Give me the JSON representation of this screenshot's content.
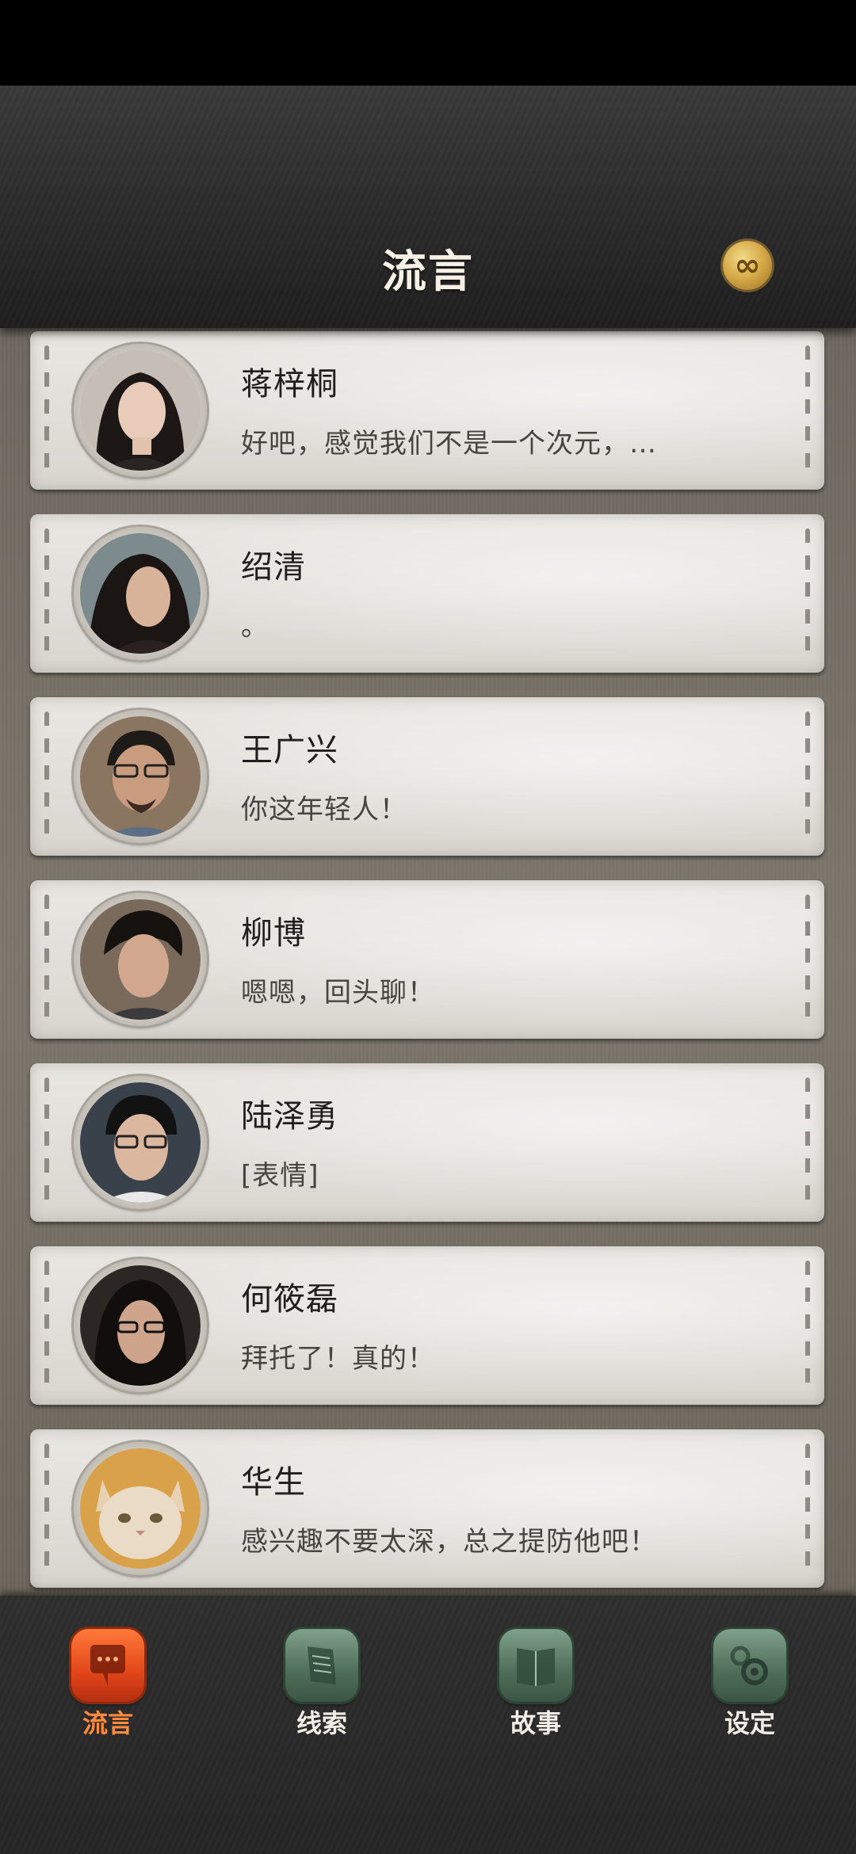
{
  "header": {
    "title": "流言",
    "coin_icon": "infinity-coin-icon",
    "coin_symbol": "∞"
  },
  "contacts": [
    {
      "name": "蒋梓桐",
      "message": "好吧，感觉我们不是一个次元，…"
    },
    {
      "name": "绍清",
      "message": "。"
    },
    {
      "name": "王广兴",
      "message": "你这年轻人！"
    },
    {
      "name": "柳博",
      "message": "嗯嗯，回头聊！"
    },
    {
      "name": "陆泽勇",
      "message": "[表情]"
    },
    {
      "name": "何筱磊",
      "message": "拜托了！真的！"
    },
    {
      "name": "华生",
      "message": "感兴趣不要太深，总之提防他吧！"
    }
  ],
  "nav": {
    "tabs": [
      {
        "label": "流言",
        "icon": "chat-bubble-icon",
        "active": true
      },
      {
        "label": "线索",
        "icon": "notes-icon",
        "active": false
      },
      {
        "label": "故事",
        "icon": "book-icon",
        "active": false
      },
      {
        "label": "设定",
        "icon": "gear-icon",
        "active": false
      }
    ]
  },
  "colors": {
    "active_tab": "#ff8a3c",
    "inactive_tab": "#5e7f69",
    "card": "#e3e0da",
    "header": "#2e2e2e"
  }
}
